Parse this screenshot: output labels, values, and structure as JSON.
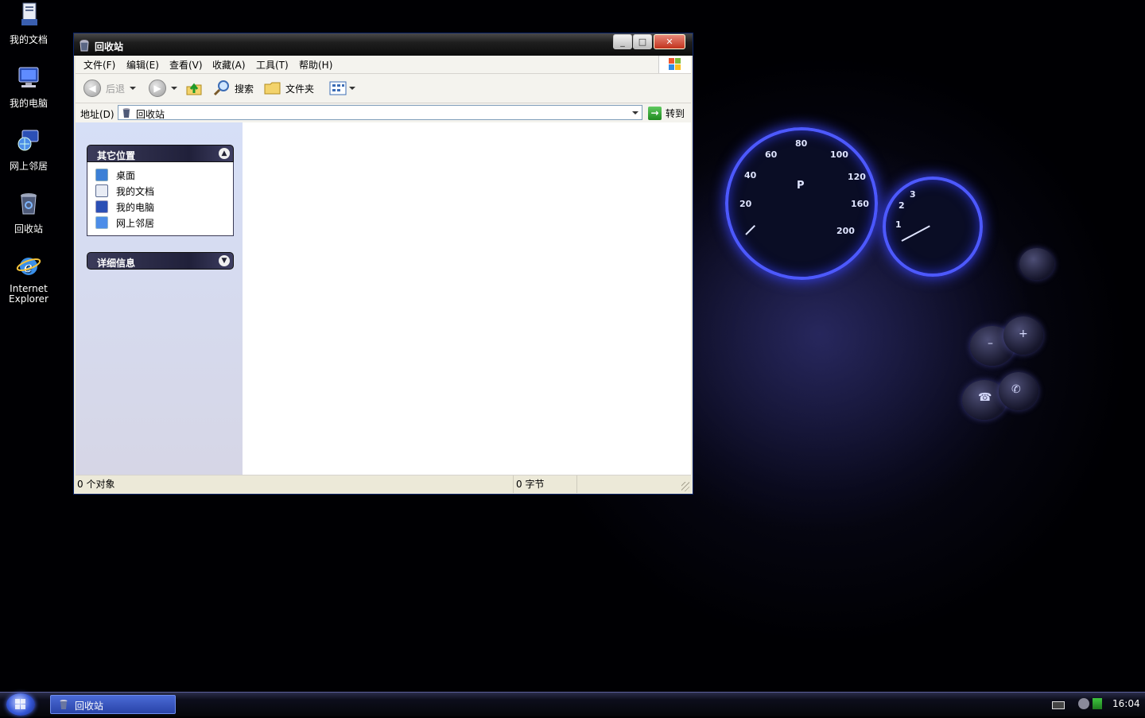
{
  "desktop": {
    "icons": [
      {
        "label": "我的文档"
      },
      {
        "label": "我的电脑"
      },
      {
        "label": "网上邻居"
      },
      {
        "label": "回收站"
      },
      {
        "label": "Internet Explorer"
      }
    ]
  },
  "wallpaper": {
    "speedometer": [
      "20",
      "40",
      "60",
      "80",
      "100",
      "120",
      "160",
      "200"
    ],
    "speedometer_center": "P",
    "tach": [
      "1",
      "2",
      "3"
    ]
  },
  "window": {
    "title": "回收站",
    "controls": {
      "minimize": "_",
      "maximize": "□",
      "close": "✕"
    },
    "menu": [
      "文件(F)",
      "编辑(E)",
      "查看(V)",
      "收藏(A)",
      "工具(T)",
      "帮助(H)"
    ],
    "toolbar": {
      "back": "后退",
      "search": "搜索",
      "folders": "文件夹"
    },
    "address": {
      "label": "地址(D)",
      "value": "回收站",
      "go": "转到"
    },
    "sidebar": {
      "other_places": {
        "title": "其它位置",
        "items": [
          "桌面",
          "我的文档",
          "我的电脑",
          "网上邻居"
        ]
      },
      "details": {
        "title": "详细信息"
      }
    },
    "status": {
      "objects": "0 个对象",
      "size": "0 字节"
    }
  },
  "taskbar": {
    "task": "回收站",
    "clock": "16:04"
  },
  "colors": {
    "titlebar": "#1f1f1f",
    "window_frame": "#0a246a",
    "taskbar_button": "#2a44a8",
    "gauge_glow": "#4d59ff"
  }
}
